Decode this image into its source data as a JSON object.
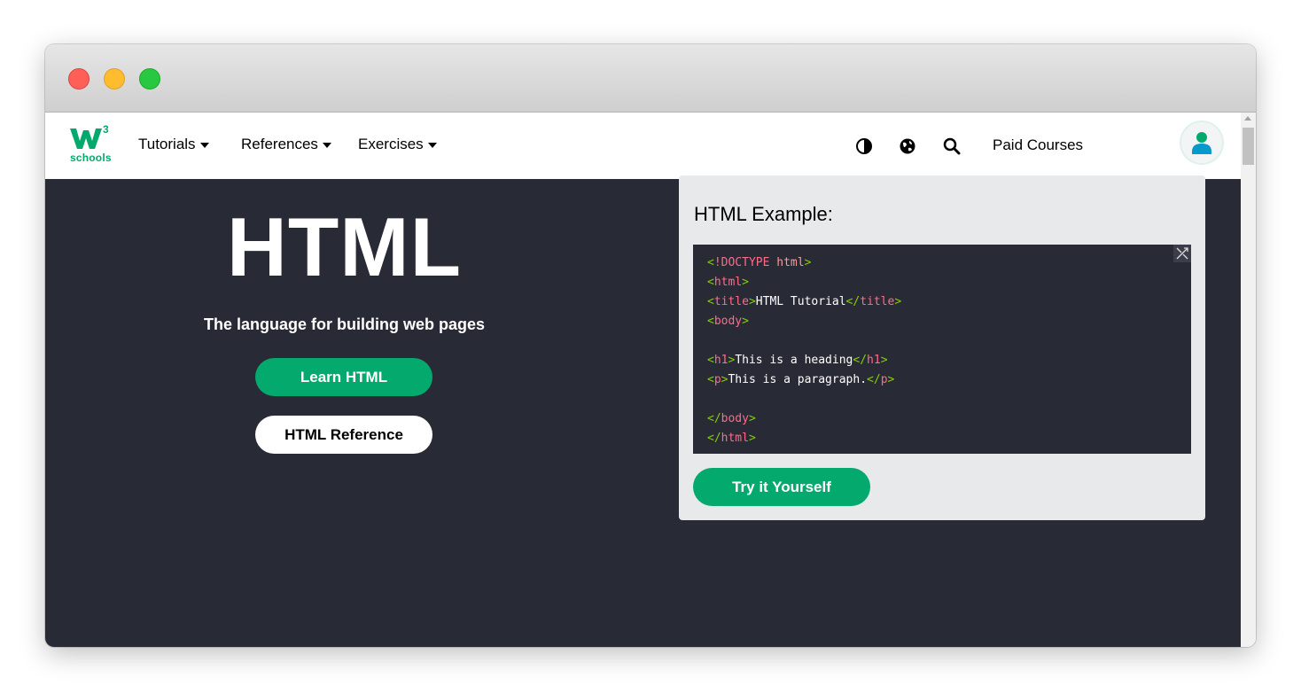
{
  "window": {
    "controls": [
      "close",
      "minimize",
      "zoom"
    ]
  },
  "navbar": {
    "logo_text": "schools",
    "logo_superscript": "3",
    "items": [
      {
        "label": "Tutorials"
      },
      {
        "label": "References"
      },
      {
        "label": "Exercises"
      }
    ],
    "icons": [
      "contrast-icon",
      "globe-icon",
      "search-icon"
    ],
    "paid_courses": "Paid Courses",
    "avatar_icon": "user-icon"
  },
  "hero": {
    "title": "HTML",
    "subtitle": "The language for building web pages",
    "learn_button": "Learn HTML",
    "reference_button": "HTML Reference"
  },
  "example": {
    "title": "HTML Example:",
    "code": [
      [
        {
          "c": "br",
          "t": "<"
        },
        {
          "c": "dt",
          "t": "!DOCTYPE"
        },
        {
          "c": "at",
          "t": " html"
        },
        {
          "c": "br",
          "t": ">"
        }
      ],
      [
        {
          "c": "br",
          "t": "<"
        },
        {
          "c": "nm",
          "t": "html"
        },
        {
          "c": "br",
          "t": ">"
        }
      ],
      [
        {
          "c": "br",
          "t": "<"
        },
        {
          "c": "nm",
          "t": "title"
        },
        {
          "c": "br",
          "t": ">"
        },
        {
          "c": "ct",
          "t": "HTML Tutorial"
        },
        {
          "c": "br",
          "t": "</"
        },
        {
          "c": "nm",
          "t": "title"
        },
        {
          "c": "br",
          "t": ">"
        }
      ],
      [
        {
          "c": "br",
          "t": "<"
        },
        {
          "c": "nm",
          "t": "body"
        },
        {
          "c": "br",
          "t": ">"
        }
      ],
      [],
      [
        {
          "c": "br",
          "t": "<"
        },
        {
          "c": "nm",
          "t": "h1"
        },
        {
          "c": "br",
          "t": ">"
        },
        {
          "c": "ct",
          "t": "This is a heading"
        },
        {
          "c": "br",
          "t": "</"
        },
        {
          "c": "nm",
          "t": "h1"
        },
        {
          "c": "br",
          "t": ">"
        }
      ],
      [
        {
          "c": "br",
          "t": "<"
        },
        {
          "c": "nm",
          "t": "p"
        },
        {
          "c": "br",
          "t": ">"
        },
        {
          "c": "ct",
          "t": "This is a paragraph."
        },
        {
          "c": "br",
          "t": "</"
        },
        {
          "c": "nm",
          "t": "p"
        },
        {
          "c": "br",
          "t": ">"
        }
      ],
      [],
      [
        {
          "c": "br",
          "t": "</"
        },
        {
          "c": "nm",
          "t": "body"
        },
        {
          "c": "br",
          "t": ">"
        }
      ],
      [
        {
          "c": "br",
          "t": "</"
        },
        {
          "c": "nm",
          "t": "html"
        },
        {
          "c": "br",
          "t": ">"
        }
      ]
    ],
    "expand_icon": "expand-icon",
    "try_button": "Try it Yourself"
  },
  "colors": {
    "brand_green": "#04aa6d",
    "hero_bg": "#282a35",
    "example_bg": "#e7e9eb"
  }
}
